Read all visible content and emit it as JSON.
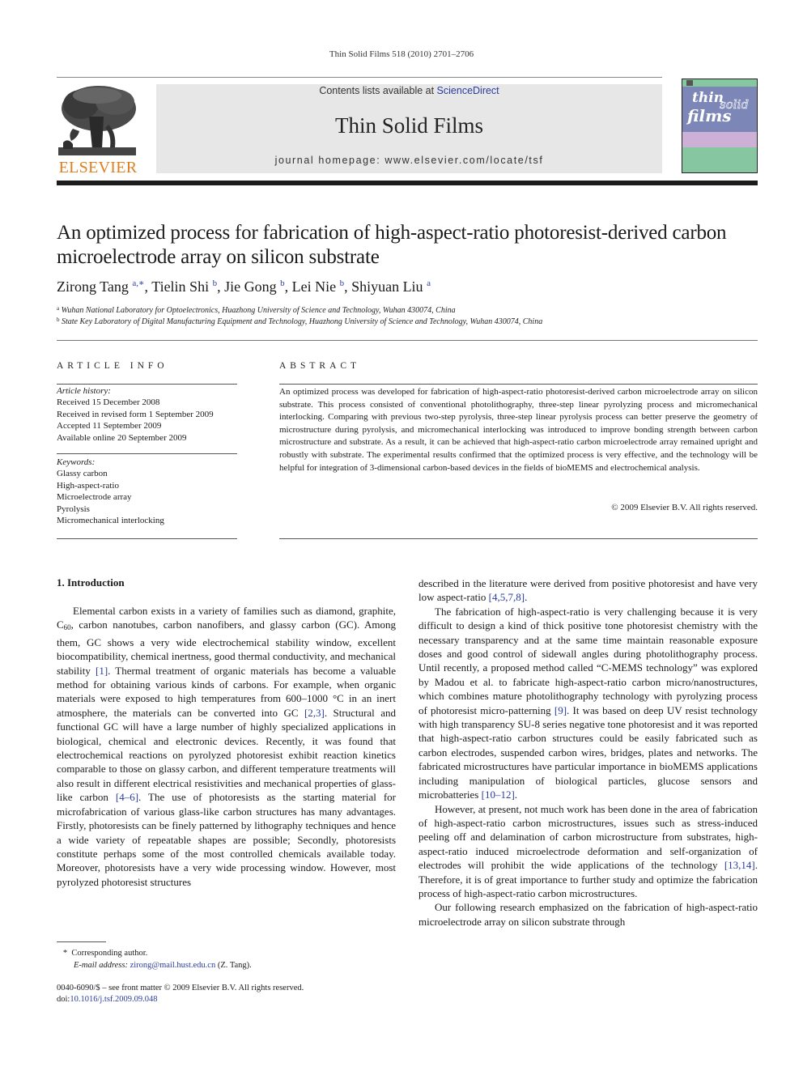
{
  "running_head": "Thin Solid Films 518 (2010) 2701–2706",
  "header": {
    "publisher_logo_text": "ELSEVIER",
    "contents_prefix": "Contents lists available at ",
    "contents_link": "ScienceDirect",
    "journal_title": "Thin Solid Films",
    "homepage_prefix": "journal homepage: ",
    "homepage_url": "www.elsevier.com/locate/tsf",
    "cover": {
      "line1": "thin",
      "line2": "solid",
      "line3": "films"
    },
    "colors": {
      "elsevier_orange": "#e07e1e",
      "gray_box": "#e7e7e8",
      "link_blue": "#2a3d9e",
      "cover_green": "#86c6a0",
      "cover_blue": "#7c87b8",
      "cover_pink": "#cdb0d6"
    }
  },
  "article": {
    "title": "An optimized process for fabrication of high-aspect-ratio photoresist-derived carbon microelectrode array on silicon substrate",
    "authors": [
      {
        "name": "Zirong Tang",
        "sup": "a,∗",
        "sep": ", "
      },
      {
        "name": "Tielin Shi",
        "sup": "b",
        "sep": ", "
      },
      {
        "name": "Jie Gong",
        "sup": "b",
        "sep": ", "
      },
      {
        "name": "Lei Nie",
        "sup": "b",
        "sep": ", "
      },
      {
        "name": "Shiyuan Liu",
        "sup": "a",
        "sep": ""
      }
    ],
    "affiliations": [
      {
        "mark": "a",
        "text": "Wuhan National Laboratory for Optoelectronics, Huazhong University of Science and Technology, Wuhan 430074, China"
      },
      {
        "mark": "b",
        "text": "State Key Laboratory of Digital Manufacturing Equipment and Technology, Huazhong University of Science and Technology, Wuhan 430074, China"
      }
    ]
  },
  "article_info": {
    "heading": "ARTICLE INFO",
    "history_label": "Article history:",
    "history": [
      "Received 15 December 2008",
      "Received in revised form 1 September 2009",
      "Accepted 11 September 2009",
      "Available online 20 September 2009"
    ],
    "keywords_label": "Keywords:",
    "keywords": [
      "Glassy carbon",
      "High-aspect-ratio",
      "Microelectrode array",
      "Pyrolysis",
      "Micromechanical interlocking"
    ]
  },
  "abstract": {
    "heading": "ABSTRACT",
    "text": "An optimized process was developed for fabrication of high-aspect-ratio photoresist-derived carbon microelectrode array on silicon substrate. This process consisted of conventional photolithography, three-step linear pyrolyzing process and micromechanical interlocking. Comparing with previous two-step pyrolysis, three-step linear pyrolysis process can better preserve the geometry of microstructure during pyrolysis, and micromechanical interlocking was introduced to improve bonding strength between carbon microstructure and substrate. As a result, it can be achieved that high-aspect-ratio carbon microelectrode array remained upright and robustly with substrate. The experimental results confirmed that the optimized process is very effective, and the technology will be helpful for integration of 3-dimensional carbon-based devices in the fields of bioMEMS and electrochemical analysis.",
    "copyright": "© 2009 Elsevier B.V. All rights reserved."
  },
  "body": {
    "section_heading": "1. Introduction",
    "left_p1": [
      {
        "t": "Elemental carbon exists in a variety of families such as diamond, graphite, C"
      },
      {
        "sub": "60"
      },
      {
        "t": ", carbon nanotubes, carbon nanofibers, and glassy carbon (GC). Among them, GC shows a very wide electrochemical stability window, excellent biocompatibility, chemical inertness, good thermal conductivity, and mechanical stability "
      },
      {
        "ref": "[1]"
      },
      {
        "t": ". Thermal treatment of organic materials has become a valuable method for obtaining various kinds of carbons. For example, when organic materials were exposed to high temperatures from 600–1000 °C in an inert atmosphere, the materials can be converted into GC "
      },
      {
        "ref": "[2,3]"
      },
      {
        "t": ". Structural and functional GC will have a large number of highly specialized applications in biological, chemical and electronic devices. Recently, it was found that electrochemical reactions on pyrolyzed photoresist exhibit reaction kinetics comparable to those on glassy carbon, and different temperature treatments will also result in different electrical resistivities and mechanical properties of glass-like carbon "
      },
      {
        "ref": "[4–6]"
      },
      {
        "t": ". The use of photoresists as the starting material for microfabrication of various glass-like carbon structures has many advantages. Firstly, photoresists can be finely patterned by lithography techniques and hence a wide variety of repeatable shapes are possible; Secondly, photoresists constitute perhaps some of the most controlled chemicals available today. Moreover, photoresists have a very wide processing window. However, most pyrolyzed photoresist structures"
      }
    ],
    "right_p0": [
      {
        "t": "described in the literature were derived from positive photoresist and have very low aspect-ratio "
      },
      {
        "ref": "[4,5,7,8]"
      },
      {
        "t": "."
      }
    ],
    "right_p1": [
      {
        "t": "The fabrication of high-aspect-ratio is very challenging because it is very difficult to design a kind of thick positive tone photoresist chemistry with the necessary transparency and at the same time maintain reasonable exposure doses and good control of sidewall angles during photolithography process. Until recently, a proposed method called “C-MEMS technology” was explored by Madou et al. to fabricate high-aspect-ratio carbon micro/nanostructures, which combines mature photolithography technology with pyrolyzing process of photoresist micro-patterning "
      },
      {
        "ref": "[9]"
      },
      {
        "t": ". It was based on deep UV resist technology with high transparency SU-8 series negative tone photoresist and it was reported that high-aspect-ratio carbon structures could be easily fabricated such as carbon electrodes, suspended carbon wires, bridges, plates and networks. The fabricated microstructures have particular importance in bioMEMS applications including manipulation of biological particles, glucose sensors and microbatteries "
      },
      {
        "ref": "[10–12]"
      },
      {
        "t": "."
      }
    ],
    "right_p2": [
      {
        "t": "However, at present, not much work has been done in the area of fabrication of high-aspect-ratio carbon microstructures, issues such as stress-induced peeling off and delamination of carbon microstructure from substrates, high-aspect-ratio induced microelectrode deformation and self-organization of electrodes will prohibit the wide applications of the technology "
      },
      {
        "ref": "[13,14]"
      },
      {
        "t": ". Therefore, it is of great importance to further study and optimize the fabrication process of high-aspect-ratio carbon microstructures."
      }
    ],
    "right_p3": [
      {
        "t": "Our following research emphasized on the fabrication of high-aspect-ratio microelectrode array on silicon substrate through"
      }
    ]
  },
  "footnotes": {
    "corresponding_mark": "*",
    "corresponding_text": "Corresponding author.",
    "email_label": "E-mail address:",
    "email": "zirong@mail.hust.edu.cn",
    "email_suffix": " (Z. Tang).",
    "issn_line": "0040-6090/$ – see front matter © 2009 Elsevier B.V. All rights reserved.",
    "doi_label": "doi:",
    "doi": "10.1016/j.tsf.2009.09.048"
  }
}
